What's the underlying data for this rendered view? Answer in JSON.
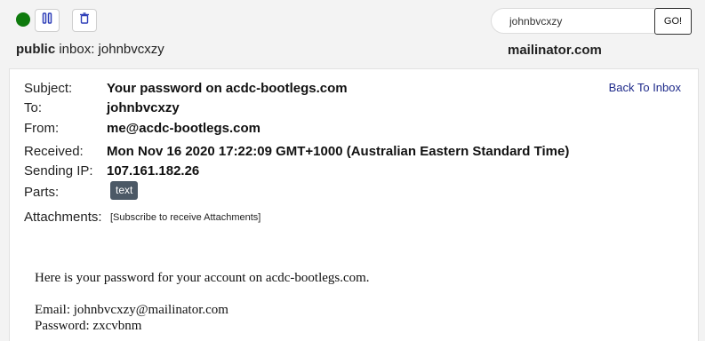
{
  "toolbar": {
    "status": "online",
    "status_color": "#0e7a0d",
    "pause_icon": "pause-icon",
    "delete_icon": "trash-icon"
  },
  "inbox": {
    "visibility": "public",
    "label": "inbox:",
    "name": "johnbvcxzy"
  },
  "search": {
    "value": "johnbvcxzy",
    "go_label": "GO!"
  },
  "site": {
    "name": "mailinator.com"
  },
  "message": {
    "back_link": "Back To Inbox",
    "subject_label": "Subject:",
    "subject": "Your password on acdc-bootlegs.com",
    "to_label": "To:",
    "to": "johnbvcxzy",
    "from_label": "From:",
    "from": "me@acdc-bootlegs.com",
    "received_label": "Received:",
    "received": "Mon Nov 16 2020 17:22:09 GMT+1000 (Australian Eastern Standard Time)",
    "ip_label": "Sending IP:",
    "ip": "107.161.182.26",
    "parts_label": "Parts:",
    "parts": [
      "text"
    ],
    "attachments_label": "Attachments:",
    "attachments_note": "[Subscribe to receive Attachments]",
    "body": {
      "line1": "Here is your password for your account on acdc-bootlegs.com.",
      "line2": "Email: johnbvcxzy@mailinator.com",
      "line3": "Password: zxcvbnm"
    }
  }
}
